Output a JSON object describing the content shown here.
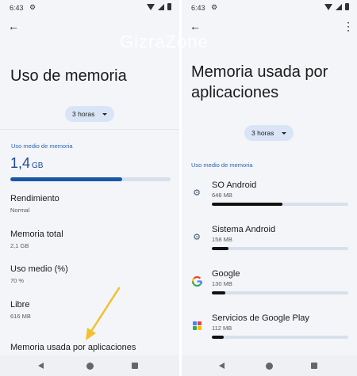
{
  "left": {
    "status": {
      "time": "6:43"
    },
    "title": "Uso de memoria",
    "time_range": "3 horas",
    "section_label": "Uso medio de memoria",
    "average": {
      "value": "1,4",
      "unit": "GB",
      "bar_fraction": 0.7
    },
    "rows": [
      {
        "title": "Rendimiento",
        "value": "Normal"
      },
      {
        "title": "Memoria total",
        "value": "2,1 GB"
      },
      {
        "title": "Uso medio (%)",
        "value": "70 %"
      },
      {
        "title": "Libre",
        "value": "616 MB"
      }
    ],
    "apps_row": "Memoria usada por aplicaciones"
  },
  "right": {
    "status": {
      "time": "6:43"
    },
    "title": "Memoria usada por aplicaciones",
    "time_range": "3 horas",
    "section_label": "Uso medio de memoria",
    "apps": [
      {
        "name": "SO Android",
        "size": "648 MB",
        "icon": "gear-icon",
        "fraction": 0.52
      },
      {
        "name": "Sistema Android",
        "size": "158 MB",
        "icon": "gear-icon",
        "fraction": 0.12
      },
      {
        "name": "Google",
        "size": "130 MB",
        "icon": "google-icon",
        "fraction": 0.1
      },
      {
        "name": "Servicios de Google Play",
        "size": "112 MB",
        "icon": "play-services-icon",
        "fraction": 0.09
      }
    ]
  },
  "watermark": "GizraZone",
  "colors": {
    "accent": "#1a57a8",
    "section": "#2d64b7",
    "chip": "#d9e5f7",
    "arrow": "#f2c12e"
  }
}
